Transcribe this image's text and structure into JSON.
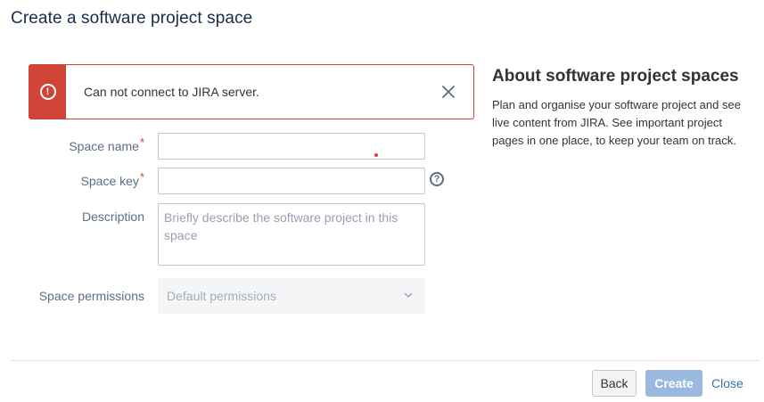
{
  "dialog": {
    "title": "Create a software project space"
  },
  "error_banner": {
    "message": "Can not connect to JIRA server."
  },
  "form": {
    "space_name": {
      "label": "Space name",
      "required_marker": "*",
      "value": ""
    },
    "space_key": {
      "label": "Space key",
      "required_marker": "*",
      "value": ""
    },
    "description": {
      "label": "Description",
      "placeholder": "Briefly describe the software project in this space"
    },
    "permissions": {
      "label": "Space permissions",
      "selected": "Default permissions"
    }
  },
  "about": {
    "title": "About software project spaces",
    "text": "Plan and organise your software project and see live content from JIRA. See important project pages in one place, to keep your team on track."
  },
  "footer": {
    "back_label": "Back",
    "create_label": "Create",
    "close_label": "Close"
  },
  "colors": {
    "error": "#d04437",
    "primary_disabled": "#99b9de",
    "link": "#3572b0"
  },
  "icons": {
    "error": "exclamation-circle-icon",
    "close": "close-icon",
    "help": "question-circle-icon",
    "dropdown": "chevron-down-icon"
  }
}
